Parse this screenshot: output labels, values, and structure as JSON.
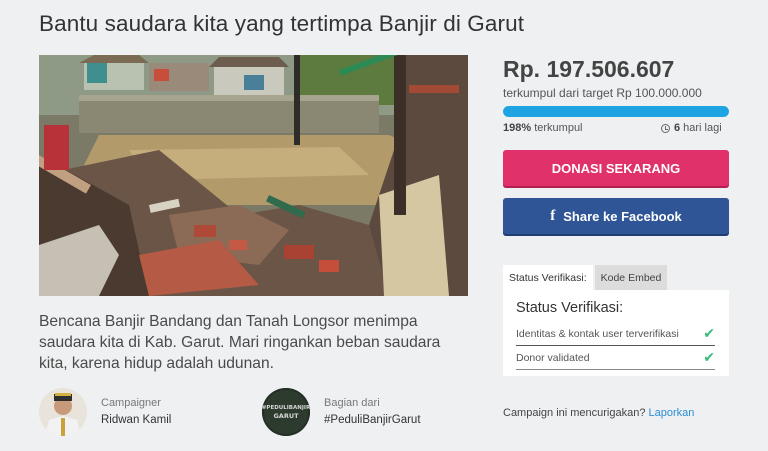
{
  "campaign": {
    "title": "Bantu saudara kita yang tertimpa Banjir di Garut",
    "description": "Bencana Banjir Bandang dan Tanah Longsor menimpa saudara kita di Kab. Garut. Mari ringankan beban saudara kita, karena hidup adalah udunan.",
    "photo_icon": "flood-photo"
  },
  "campaigner": {
    "label": "Campaigner",
    "name": "Ridwan Kamil"
  },
  "group": {
    "label": "Bagian dari",
    "name": "#PeduliBanjirGarut",
    "badge_text": "#PEDULIBANJIR GARUT"
  },
  "funding": {
    "amount": "Rp. 197.506.607",
    "target_text": "terkumpul dari target Rp 100.000.000",
    "progress_fraction": 1.0,
    "percent": "198%",
    "percent_suffix": "terkumpul",
    "days": "6",
    "days_suffix": "hari lagi"
  },
  "buttons": {
    "donate": "DONASI SEKARANG",
    "share": "Share ke Facebook",
    "share_icon": "f"
  },
  "verification": {
    "tabs": [
      "Status Verifikasi:",
      "Kode Embed"
    ],
    "title": "Status Verifikasi:",
    "items": [
      {
        "label": "Identitas & kontak user terverifikasi",
        "icon": "✔"
      },
      {
        "label": "Donor validated",
        "icon": "✔"
      }
    ]
  },
  "report": {
    "question": "Campaign ini mencurigakan?",
    "link": "Laporkan"
  },
  "colors": {
    "donate": "#e0316b",
    "facebook": "#2f5596",
    "progress": "#1ea4e3",
    "check": "#3aba7c"
  }
}
